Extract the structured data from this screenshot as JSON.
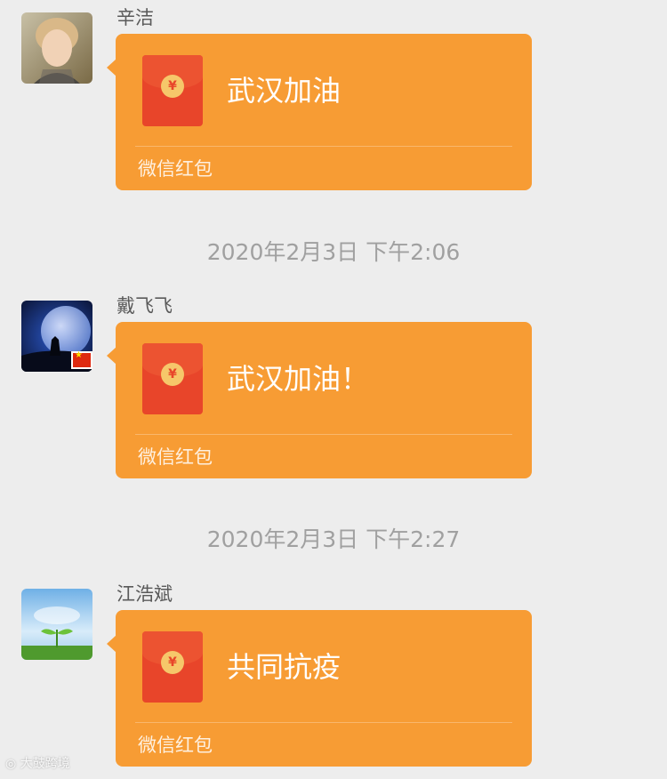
{
  "chat": {
    "messages": [
      {
        "sender": "辛洁",
        "avatar": "portrait-photo",
        "card": {
          "icon": "red-envelope-icon",
          "coin_symbol": "¥",
          "greeting": "武汉加油",
          "footer": "微信红包"
        }
      },
      {
        "sender": "戴飞飞",
        "avatar": "moon-night-photo",
        "badge": "china-flag",
        "card": {
          "icon": "red-envelope-icon",
          "coin_symbol": "¥",
          "greeting": "武汉加油！",
          "footer": "微信红包"
        }
      },
      {
        "sender": "江浩斌",
        "avatar": "sprout-sky-photo",
        "card": {
          "icon": "red-envelope-icon",
          "coin_symbol": "¥",
          "greeting": "共同抗疫",
          "footer": "微信红包"
        }
      }
    ],
    "timestamps": [
      "2020年2月3日 下午2:06",
      "2020年2月3日 下午2:27"
    ]
  },
  "watermark": "大鼓跨境",
  "colors": {
    "background": "#ededed",
    "bubble": "#f79c34",
    "envelope": "#e8452a",
    "coin": "#f6c76a",
    "timestamp_text": "#a0a0a0"
  }
}
